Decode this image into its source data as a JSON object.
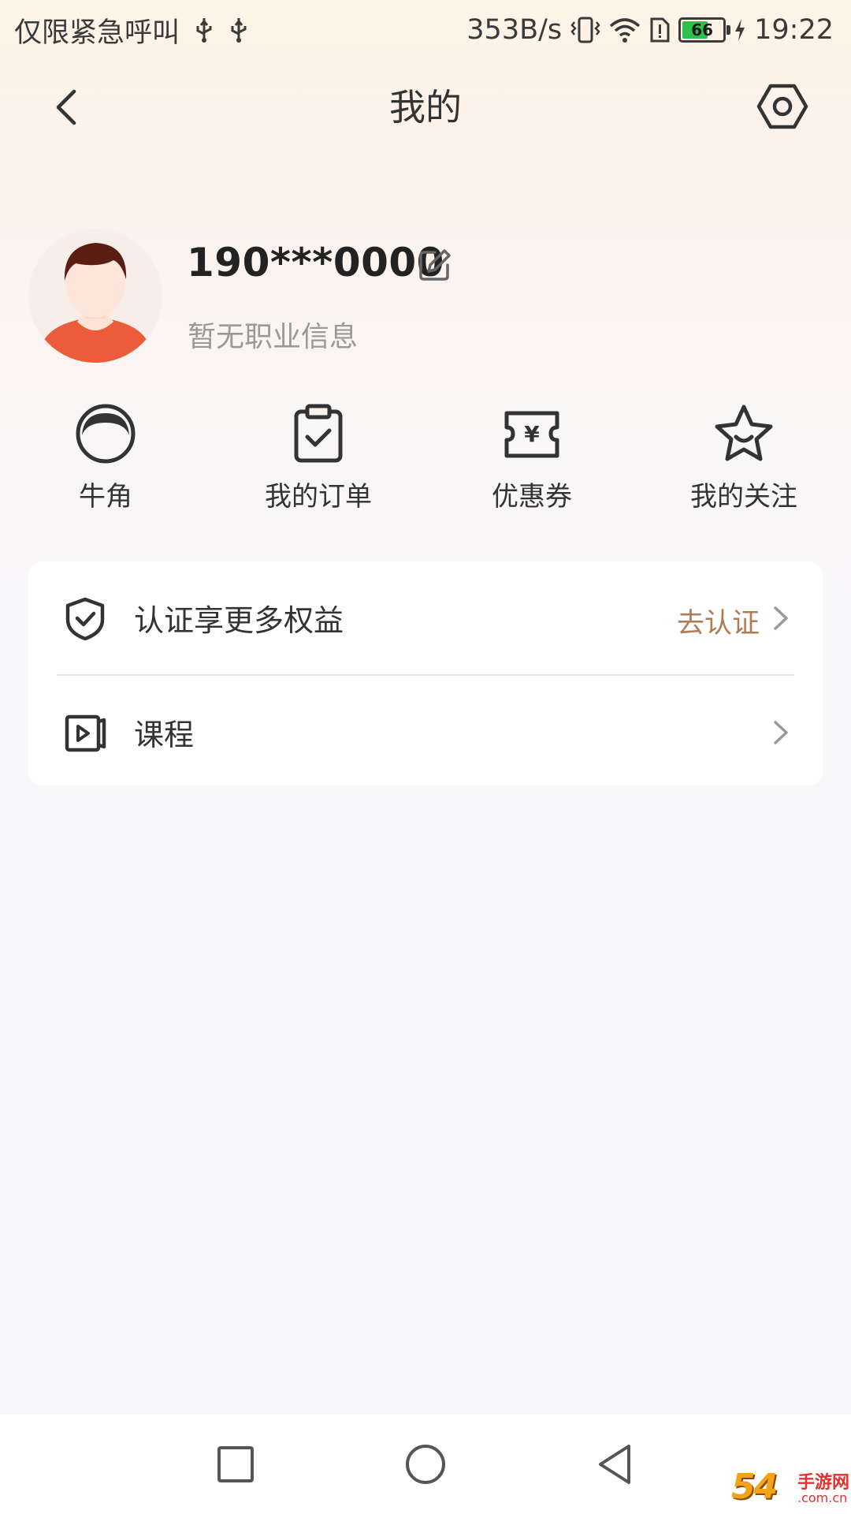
{
  "status_bar": {
    "carrier": "仅限紧急呼叫",
    "net_speed": "353B/s",
    "battery_level": 66,
    "battery_text": "66",
    "time": "19:22"
  },
  "header": {
    "title": "我的"
  },
  "profile": {
    "username": "190***0000",
    "job_info": "暂无职业信息"
  },
  "shortcuts": [
    {
      "label": "牛角",
      "icon": "horn-icon"
    },
    {
      "label": "我的订单",
      "icon": "order-icon"
    },
    {
      "label": "优惠券",
      "icon": "coupon-icon"
    },
    {
      "label": "我的关注",
      "icon": "star-icon"
    }
  ],
  "menu": {
    "certify": {
      "label": "认证享更多权益",
      "action": "去认证",
      "icon": "shield-check-icon"
    },
    "course": {
      "label": "课程",
      "icon": "video-course-icon"
    }
  },
  "watermark": {
    "number": "54",
    "brand": "手游网",
    "domain": ".com.cn"
  },
  "colors": {
    "accent": "#b07c55",
    "text": "#333333",
    "muted": "#999999",
    "battery": "#2fbf4b"
  }
}
